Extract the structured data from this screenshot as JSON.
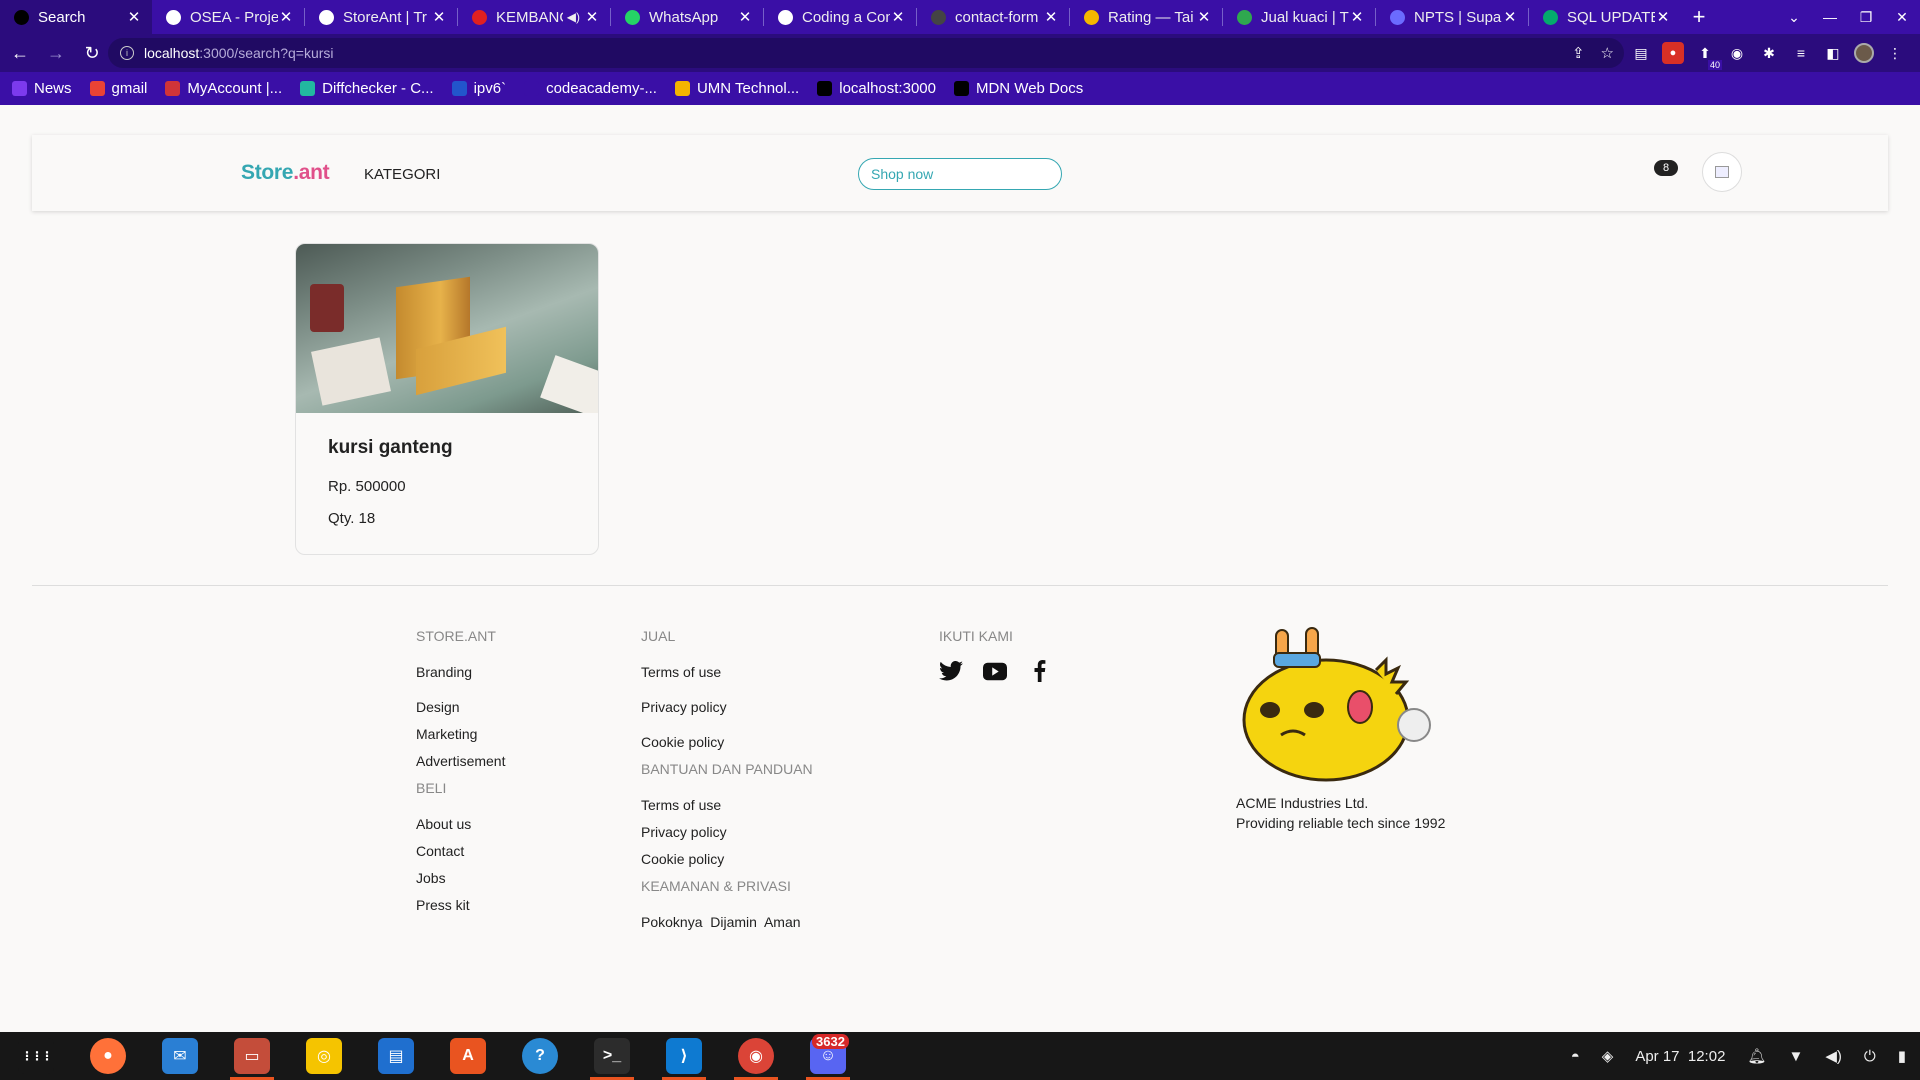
{
  "browser": {
    "tabs": [
      {
        "title": "Search",
        "icon_color": "#000000",
        "active": true,
        "icon": "vercel-icon"
      },
      {
        "title": "OSEA - Proje",
        "icon_color": "#ffffff",
        "icon": "globe-icon"
      },
      {
        "title": "StoreAnt | Tr",
        "icon_color": "#ffffff",
        "icon": "trello-icon"
      },
      {
        "title": "KEMBANG",
        "icon_color": "#e02020",
        "icon": "youtube-icon",
        "sound": true
      },
      {
        "title": "WhatsApp",
        "icon_color": "#25d366",
        "icon": "whatsapp-icon"
      },
      {
        "title": "Coding a Con",
        "icon_color": "#ffffff",
        "icon": "codepen-icon"
      },
      {
        "title": "contact-form",
        "icon_color": "#444444",
        "icon": "github-icon"
      },
      {
        "title": "Rating — Tai",
        "icon_color": "#f5b800",
        "icon": "flower-icon"
      },
      {
        "title": "Jual kuaci | T",
        "icon_color": "#2fa84f",
        "icon": "tokopedia-icon"
      },
      {
        "title": "NPTS | Supab",
        "icon_color": "#6b6bff",
        "icon": "bolt-icon"
      },
      {
        "title": "SQL UPDATE",
        "icon_color": "#04aa6d",
        "icon": "w3schools-icon"
      }
    ],
    "url_host": "localhost",
    "url_path": ":3000/search?q=kursi",
    "bookmarks": [
      {
        "label": "News",
        "icon_color": "#7c3aed",
        "icon": "news-icon"
      },
      {
        "label": "gmail",
        "icon_color": "#ea4335",
        "icon": "gmail-icon"
      },
      {
        "label": "MyAccount |...",
        "icon_color": "#d13438",
        "icon": "rocket-icon"
      },
      {
        "label": "Diffchecker - C...",
        "icon_color": "#22b8a0",
        "icon": "diffchecker-icon"
      },
      {
        "label": "ipv6`",
        "icon_color": "#2255cc",
        "icon": "h-icon"
      },
      {
        "label": "codeacademy-...",
        "icon_color": "#3a0fa6",
        "icon": "blank-icon"
      },
      {
        "label": "UMN Technol...",
        "icon_color": "#f4b400",
        "icon": "drive-icon"
      },
      {
        "label": "localhost:3000",
        "icon_color": "#000000",
        "icon": "vercel-icon"
      },
      {
        "label": "MDN Web Docs",
        "icon_color": "#000000",
        "icon": "mdn-icon"
      }
    ],
    "extension_badge": "40"
  },
  "header": {
    "logo_part1": "Store",
    "logo_part2": ".ant",
    "kategori": "KATEGORI",
    "search_placeholder": "Shop now",
    "cart_count": "8"
  },
  "products": [
    {
      "name": "kursi ganteng",
      "price": "Rp. 500000",
      "qty": "Qty. 18"
    }
  ],
  "footer": {
    "col1": {
      "heading": "STORE.ANT",
      "links": [
        "Branding",
        "Design",
        "Marketing",
        "Advertisement"
      ],
      "heading2": "BELI",
      "links2": [
        "About us",
        "Contact",
        "Jobs",
        "Press kit"
      ]
    },
    "col2": {
      "heading": "JUAL",
      "links": [
        "Terms of use",
        "Privacy policy",
        "Cookie policy"
      ],
      "heading2": "BANTUAN DAN PANDUAN",
      "links2": [
        "Terms of use",
        "Privacy policy",
        "Cookie policy"
      ],
      "heading3": "KEAMANAN & PRIVASI",
      "text3": "Pokoknya  Dijamin  Aman"
    },
    "col3": {
      "heading": "IKUTI KAMI",
      "social": [
        "twitter-icon",
        "youtube-icon",
        "facebook-icon"
      ]
    },
    "company_name": "ACME Industries Ltd.",
    "company_tagline": "Providing reliable tech since 1992"
  },
  "taskbar": {
    "apps": [
      {
        "name": "app-grid-icon",
        "color": "#171717"
      },
      {
        "name": "firefox-icon",
        "color": "#ff7139"
      },
      {
        "name": "thunderbird-icon",
        "color": "#2a7fd4"
      },
      {
        "name": "files-icon",
        "color": "#c44d3a",
        "running": true
      },
      {
        "name": "rhythmbox-icon",
        "color": "#f5c400"
      },
      {
        "name": "writer-icon",
        "color": "#1f6fcf"
      },
      {
        "name": "software-icon",
        "color": "#e95420"
      },
      {
        "name": "help-icon",
        "color": "#2a8ad4"
      },
      {
        "name": "terminal-icon",
        "color": "#2c2c2c",
        "running": true
      },
      {
        "name": "vscode-icon",
        "color": "#0e7ad1",
        "running": true
      },
      {
        "name": "chrome-icon",
        "color": "#db4437",
        "running": true
      },
      {
        "name": "discord-icon",
        "color": "#5865f2",
        "running": true,
        "count": "3632"
      }
    ],
    "date": "Apr 17",
    "time": "12:02"
  }
}
